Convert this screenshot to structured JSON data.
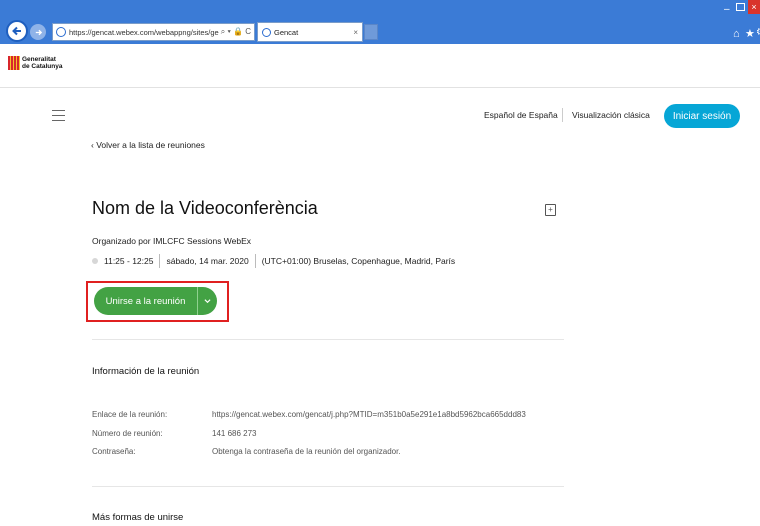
{
  "browser": {
    "url": "https://gencat.webex.com/webappng/sites/gencat/n",
    "url_controls": "⌕ ▾ 🔒 C",
    "tab_title": "Gencat",
    "tab_close": "×",
    "minimize": "–",
    "close": "×",
    "home": "⌂",
    "favorites": "★",
    "settings": "⚙"
  },
  "gencat": {
    "line1": "Generalitat",
    "line2": "de Catalunya"
  },
  "nav": {
    "language": "Español de España",
    "classic_view": "Visualización clásica",
    "login": "Iniciar sesión"
  },
  "meeting": {
    "back_link": "‹ Volver a la lista de reuniones",
    "title": "Nom de la Videoconferència",
    "add_calendar": "+",
    "host": "Organizado por IMLCFC Sessions WebEx",
    "time": "11:25 - 12:25",
    "date": "sábado, 14 mar. 2020",
    "timezone": "(UTC+01:00) Bruselas, Copenhague, Madrid, París",
    "join_label": "Unirse a la reunión"
  },
  "info": {
    "section_title": "Información de la reunión",
    "link_label": "Enlace de la reunión:",
    "link_value": "https://gencat.webex.com/gencat/j.php?MTID=m351b0a5e291e1a8bd5962bca665ddd83",
    "number_label": "Número de reunión:",
    "number_value": "141 686 273",
    "password_label": "Contraseña:",
    "password_value": "Obtenga la contraseña de la reunión del organizador."
  },
  "more": {
    "section_title": "Más formas de unirse"
  },
  "colors": {
    "chrome": "#3b7bd6",
    "join_green": "#43a244",
    "login_blue": "#06a6d6",
    "highlight_red": "#e02020"
  }
}
